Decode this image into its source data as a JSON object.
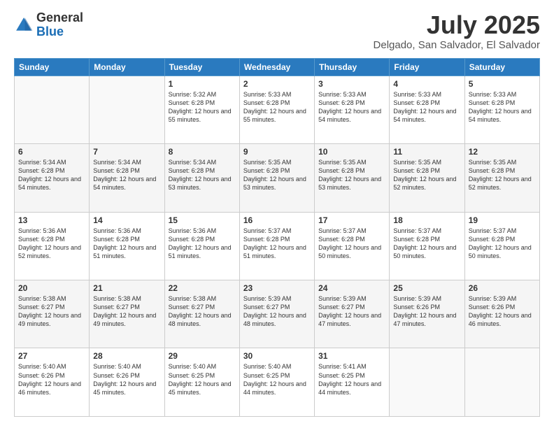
{
  "logo": {
    "line1": "General",
    "line2": "Blue"
  },
  "header": {
    "month": "July 2025",
    "location": "Delgado, San Salvador, El Salvador"
  },
  "weekdays": [
    "Sunday",
    "Monday",
    "Tuesday",
    "Wednesday",
    "Thursday",
    "Friday",
    "Saturday"
  ],
  "weeks": [
    [
      {
        "day": "",
        "sunrise": "",
        "sunset": "",
        "daylight": ""
      },
      {
        "day": "",
        "sunrise": "",
        "sunset": "",
        "daylight": ""
      },
      {
        "day": "1",
        "sunrise": "Sunrise: 5:32 AM",
        "sunset": "Sunset: 6:28 PM",
        "daylight": "Daylight: 12 hours and 55 minutes."
      },
      {
        "day": "2",
        "sunrise": "Sunrise: 5:33 AM",
        "sunset": "Sunset: 6:28 PM",
        "daylight": "Daylight: 12 hours and 55 minutes."
      },
      {
        "day": "3",
        "sunrise": "Sunrise: 5:33 AM",
        "sunset": "Sunset: 6:28 PM",
        "daylight": "Daylight: 12 hours and 54 minutes."
      },
      {
        "day": "4",
        "sunrise": "Sunrise: 5:33 AM",
        "sunset": "Sunset: 6:28 PM",
        "daylight": "Daylight: 12 hours and 54 minutes."
      },
      {
        "day": "5",
        "sunrise": "Sunrise: 5:33 AM",
        "sunset": "Sunset: 6:28 PM",
        "daylight": "Daylight: 12 hours and 54 minutes."
      }
    ],
    [
      {
        "day": "6",
        "sunrise": "Sunrise: 5:34 AM",
        "sunset": "Sunset: 6:28 PM",
        "daylight": "Daylight: 12 hours and 54 minutes."
      },
      {
        "day": "7",
        "sunrise": "Sunrise: 5:34 AM",
        "sunset": "Sunset: 6:28 PM",
        "daylight": "Daylight: 12 hours and 54 minutes."
      },
      {
        "day": "8",
        "sunrise": "Sunrise: 5:34 AM",
        "sunset": "Sunset: 6:28 PM",
        "daylight": "Daylight: 12 hours and 53 minutes."
      },
      {
        "day": "9",
        "sunrise": "Sunrise: 5:35 AM",
        "sunset": "Sunset: 6:28 PM",
        "daylight": "Daylight: 12 hours and 53 minutes."
      },
      {
        "day": "10",
        "sunrise": "Sunrise: 5:35 AM",
        "sunset": "Sunset: 6:28 PM",
        "daylight": "Daylight: 12 hours and 53 minutes."
      },
      {
        "day": "11",
        "sunrise": "Sunrise: 5:35 AM",
        "sunset": "Sunset: 6:28 PM",
        "daylight": "Daylight: 12 hours and 52 minutes."
      },
      {
        "day": "12",
        "sunrise": "Sunrise: 5:35 AM",
        "sunset": "Sunset: 6:28 PM",
        "daylight": "Daylight: 12 hours and 52 minutes."
      }
    ],
    [
      {
        "day": "13",
        "sunrise": "Sunrise: 5:36 AM",
        "sunset": "Sunset: 6:28 PM",
        "daylight": "Daylight: 12 hours and 52 minutes."
      },
      {
        "day": "14",
        "sunrise": "Sunrise: 5:36 AM",
        "sunset": "Sunset: 6:28 PM",
        "daylight": "Daylight: 12 hours and 51 minutes."
      },
      {
        "day": "15",
        "sunrise": "Sunrise: 5:36 AM",
        "sunset": "Sunset: 6:28 PM",
        "daylight": "Daylight: 12 hours and 51 minutes."
      },
      {
        "day": "16",
        "sunrise": "Sunrise: 5:37 AM",
        "sunset": "Sunset: 6:28 PM",
        "daylight": "Daylight: 12 hours and 51 minutes."
      },
      {
        "day": "17",
        "sunrise": "Sunrise: 5:37 AM",
        "sunset": "Sunset: 6:28 PM",
        "daylight": "Daylight: 12 hours and 50 minutes."
      },
      {
        "day": "18",
        "sunrise": "Sunrise: 5:37 AM",
        "sunset": "Sunset: 6:28 PM",
        "daylight": "Daylight: 12 hours and 50 minutes."
      },
      {
        "day": "19",
        "sunrise": "Sunrise: 5:37 AM",
        "sunset": "Sunset: 6:28 PM",
        "daylight": "Daylight: 12 hours and 50 minutes."
      }
    ],
    [
      {
        "day": "20",
        "sunrise": "Sunrise: 5:38 AM",
        "sunset": "Sunset: 6:27 PM",
        "daylight": "Daylight: 12 hours and 49 minutes."
      },
      {
        "day": "21",
        "sunrise": "Sunrise: 5:38 AM",
        "sunset": "Sunset: 6:27 PM",
        "daylight": "Daylight: 12 hours and 49 minutes."
      },
      {
        "day": "22",
        "sunrise": "Sunrise: 5:38 AM",
        "sunset": "Sunset: 6:27 PM",
        "daylight": "Daylight: 12 hours and 48 minutes."
      },
      {
        "day": "23",
        "sunrise": "Sunrise: 5:39 AM",
        "sunset": "Sunset: 6:27 PM",
        "daylight": "Daylight: 12 hours and 48 minutes."
      },
      {
        "day": "24",
        "sunrise": "Sunrise: 5:39 AM",
        "sunset": "Sunset: 6:27 PM",
        "daylight": "Daylight: 12 hours and 47 minutes."
      },
      {
        "day": "25",
        "sunrise": "Sunrise: 5:39 AM",
        "sunset": "Sunset: 6:26 PM",
        "daylight": "Daylight: 12 hours and 47 minutes."
      },
      {
        "day": "26",
        "sunrise": "Sunrise: 5:39 AM",
        "sunset": "Sunset: 6:26 PM",
        "daylight": "Daylight: 12 hours and 46 minutes."
      }
    ],
    [
      {
        "day": "27",
        "sunrise": "Sunrise: 5:40 AM",
        "sunset": "Sunset: 6:26 PM",
        "daylight": "Daylight: 12 hours and 46 minutes."
      },
      {
        "day": "28",
        "sunrise": "Sunrise: 5:40 AM",
        "sunset": "Sunset: 6:26 PM",
        "daylight": "Daylight: 12 hours and 45 minutes."
      },
      {
        "day": "29",
        "sunrise": "Sunrise: 5:40 AM",
        "sunset": "Sunset: 6:25 PM",
        "daylight": "Daylight: 12 hours and 45 minutes."
      },
      {
        "day": "30",
        "sunrise": "Sunrise: 5:40 AM",
        "sunset": "Sunset: 6:25 PM",
        "daylight": "Daylight: 12 hours and 44 minutes."
      },
      {
        "day": "31",
        "sunrise": "Sunrise: 5:41 AM",
        "sunset": "Sunset: 6:25 PM",
        "daylight": "Daylight: 12 hours and 44 minutes."
      },
      {
        "day": "",
        "sunrise": "",
        "sunset": "",
        "daylight": ""
      },
      {
        "day": "",
        "sunrise": "",
        "sunset": "",
        "daylight": ""
      }
    ]
  ]
}
